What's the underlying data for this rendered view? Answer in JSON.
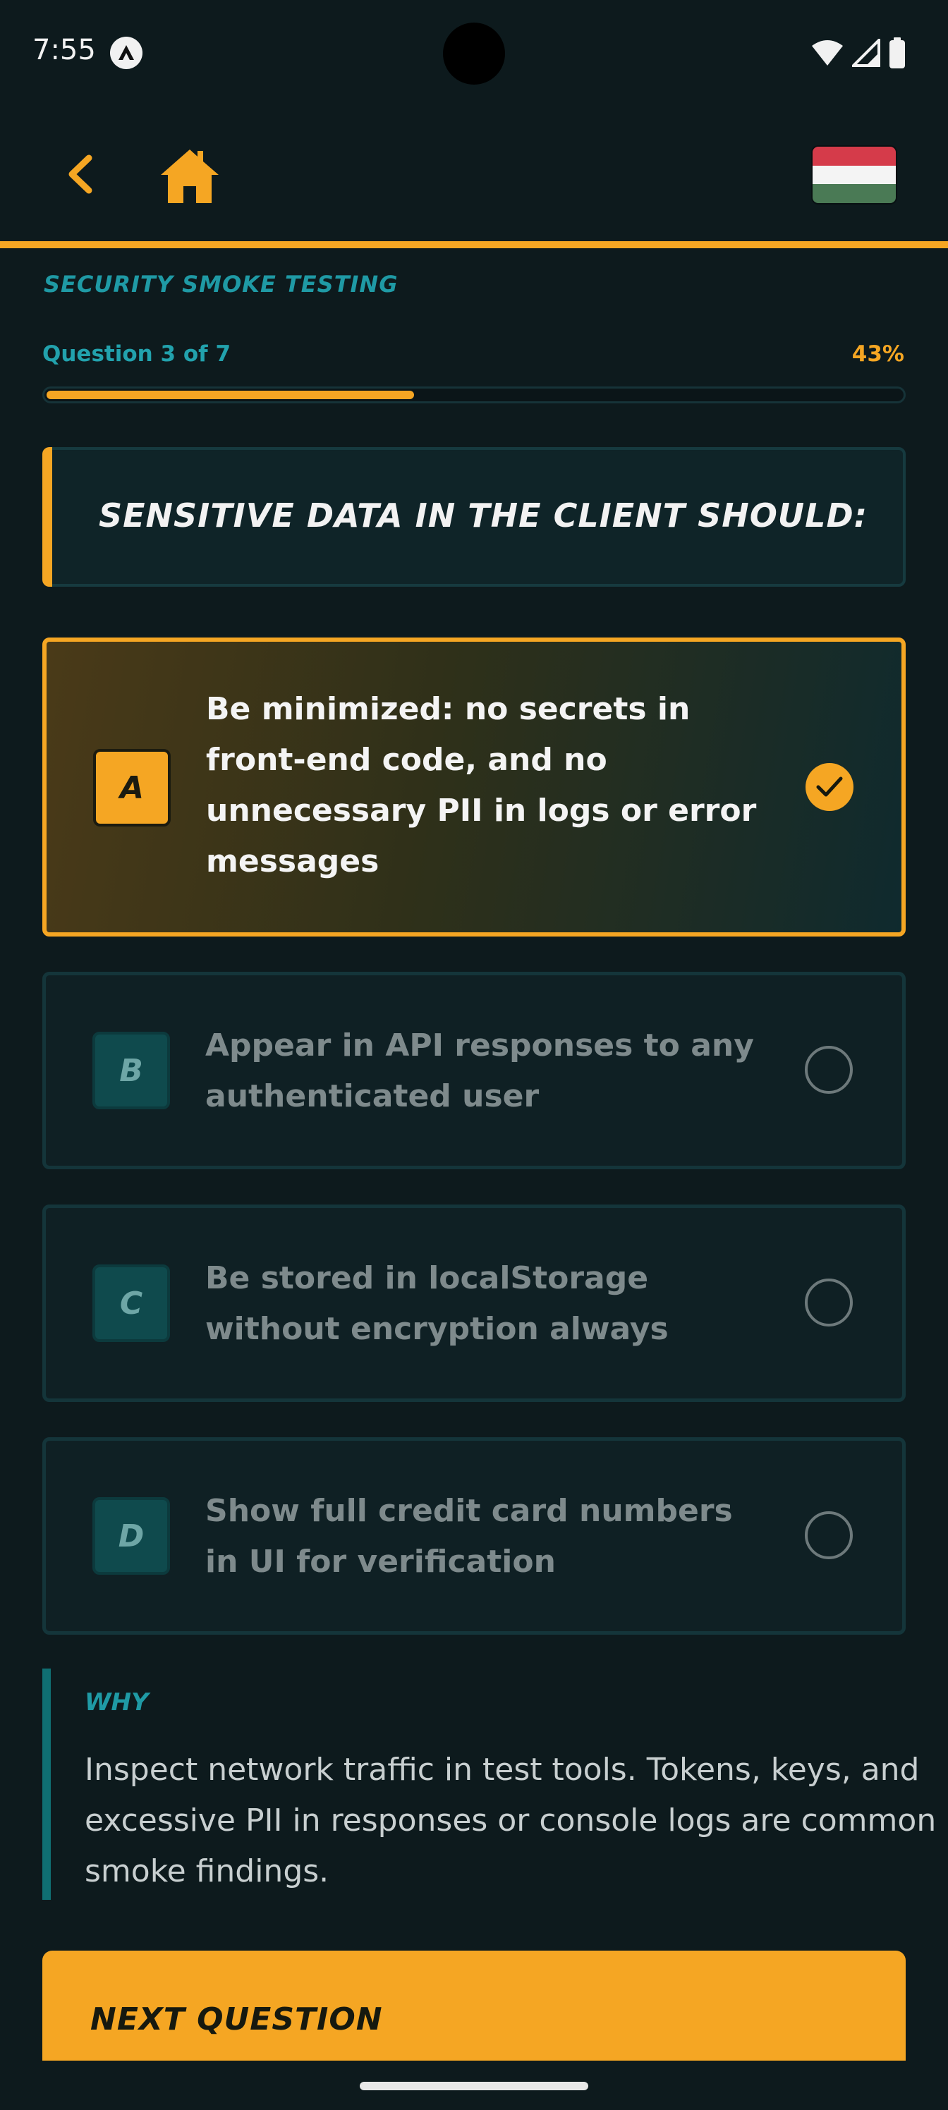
{
  "status_bar": {
    "time": "7:55",
    "icons": [
      "app-notification-icon",
      "wifi-icon",
      "signal-icon",
      "battery-icon"
    ]
  },
  "top_bar": {
    "back_icon": "chevron-left-icon",
    "home_icon": "home-icon",
    "language_flag": "hungary-flag-icon"
  },
  "quiz": {
    "section_title": "SECURITY SMOKE TESTING",
    "progress_label": "Question 3 of 7",
    "progress_percent": "43%",
    "progress_fraction": 0.43,
    "question": "SENSITIVE DATA IN THE CLIENT SHOULD:",
    "options": [
      {
        "letter": "A",
        "text": "Be minimized: no secrets in front-end code, and no unnecessary PII in logs or error messages",
        "selected": true
      },
      {
        "letter": "B",
        "text": "Appear in API responses to any authenticated user",
        "selected": false
      },
      {
        "letter": "C",
        "text": "Be stored in localStorage without encryption always",
        "selected": false
      },
      {
        "letter": "D",
        "text": "Show full credit card numbers in UI for verification",
        "selected": false
      }
    ],
    "explanation_title": "WHY",
    "explanation_text": "Inspect network traffic in test tools. Tokens, keys, and excessive PII in responses or console logs are common smoke findings.",
    "next_button_label": "NEXT QUESTION"
  },
  "colors": {
    "accent": "#f5a623",
    "teal": "#1f9aa5",
    "background": "#0d1a1d"
  }
}
